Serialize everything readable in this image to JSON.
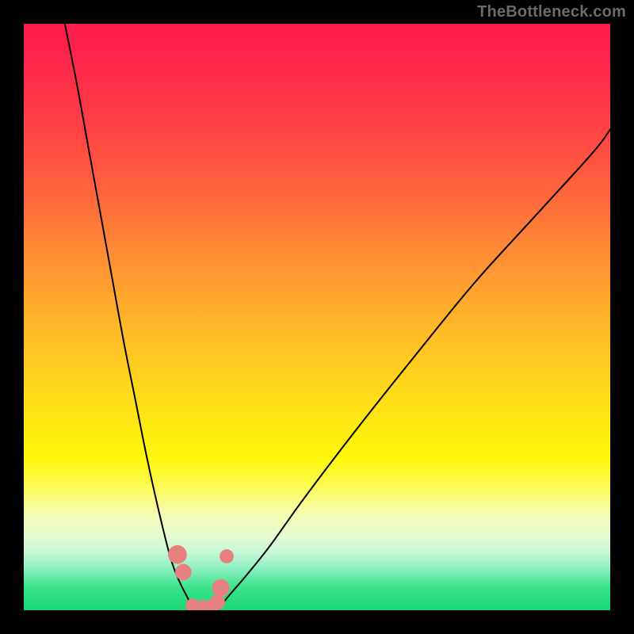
{
  "watermark": "TheBottleneck.com",
  "colors": {
    "gradient_top": "#ff1a4d",
    "gradient_mid": "#ffd21e",
    "gradient_bottom": "#17d86f",
    "curve": "#000000",
    "marker": "#e98080",
    "frame": "#000000"
  },
  "chart_data": {
    "type": "line",
    "title": "",
    "xlabel": "",
    "ylabel": "",
    "xlim": [
      0,
      100
    ],
    "ylim": [
      0,
      100
    ],
    "grid": false,
    "legend": false,
    "series": [
      {
        "name": "left-curve",
        "x": [
          7,
          9,
          11,
          13,
          15,
          17,
          19,
          21,
          23,
          25,
          26.5,
          28,
          29
        ],
        "y": [
          100,
          90,
          79,
          68,
          57,
          46,
          36,
          26,
          17,
          9,
          5,
          2,
          0
        ]
      },
      {
        "name": "right-curve",
        "x": [
          33,
          35,
          38,
          42,
          47,
          53,
          60,
          68,
          77,
          87,
          97,
          100
        ],
        "y": [
          0,
          2.5,
          6,
          11,
          18,
          26,
          35,
          45,
          56,
          67,
          78,
          82
        ]
      }
    ],
    "markers": [
      {
        "name": "left-top-blob",
        "x": 26.2,
        "y": 9.5,
        "r": 1.6
      },
      {
        "name": "left-lower-blob",
        "x": 27.2,
        "y": 6.5,
        "r": 1.4
      },
      {
        "name": "right-top-dot",
        "x": 34.6,
        "y": 9.2,
        "r": 1.2
      },
      {
        "name": "right-mid-blob",
        "x": 33.6,
        "y": 3.8,
        "r": 1.5
      },
      {
        "name": "right-lower-blob",
        "x": 33.0,
        "y": 1.4,
        "r": 1.3
      },
      {
        "name": "floor-left",
        "x": 28.8,
        "y": 0.8,
        "r": 1.2
      },
      {
        "name": "floor-mid",
        "x": 30.6,
        "y": 0.6,
        "r": 1.2
      },
      {
        "name": "floor-right",
        "x": 32.2,
        "y": 0.7,
        "r": 1.2
      }
    ],
    "floor_bar": {
      "x0": 28.2,
      "x1": 33.0,
      "y": 0.6,
      "h": 1.6
    }
  }
}
